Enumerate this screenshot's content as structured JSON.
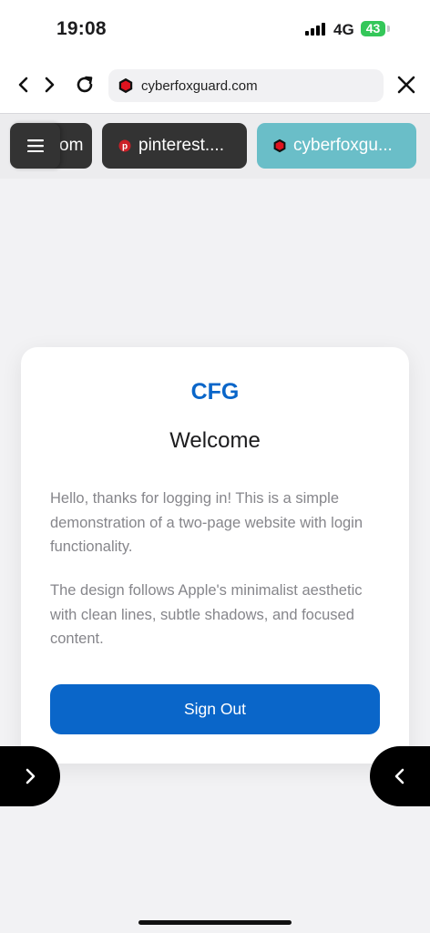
{
  "status_bar": {
    "time": "19:08",
    "network": "4G",
    "battery": "43",
    "battery_color": "#34c759"
  },
  "toolbar": {
    "back_icon": "chevron-left-icon",
    "forward_icon": "chevron-right-icon",
    "reload_icon": "reload-icon",
    "url": "cyberfoxguard.com",
    "close_icon": "close-icon"
  },
  "tabs": {
    "menu_icon": "hamburger-menu-icon",
    "items": [
      {
        "label": "om",
        "favicon": ""
      },
      {
        "label": "pinterest....",
        "favicon": "pinterest-icon"
      },
      {
        "label": "cyberfoxgu...",
        "favicon": "cyberfoxguard-icon",
        "active": true
      }
    ],
    "active_color": "#6abec8"
  },
  "card": {
    "logo": "CFG",
    "heading": "Welcome",
    "paragraph1": "Hello, thanks for logging in! This is a simple demonstration of a two-page website with login functionality.",
    "paragraph2": "The design follows Apple's minimalist aesthetic with clean lines, subtle shadows, and focused content.",
    "button_label": "Sign Out",
    "accent_color": "#0a66c9"
  },
  "edge_buttons": {
    "left_icon": "chevron-right-icon",
    "right_icon": "chevron-left-icon"
  }
}
